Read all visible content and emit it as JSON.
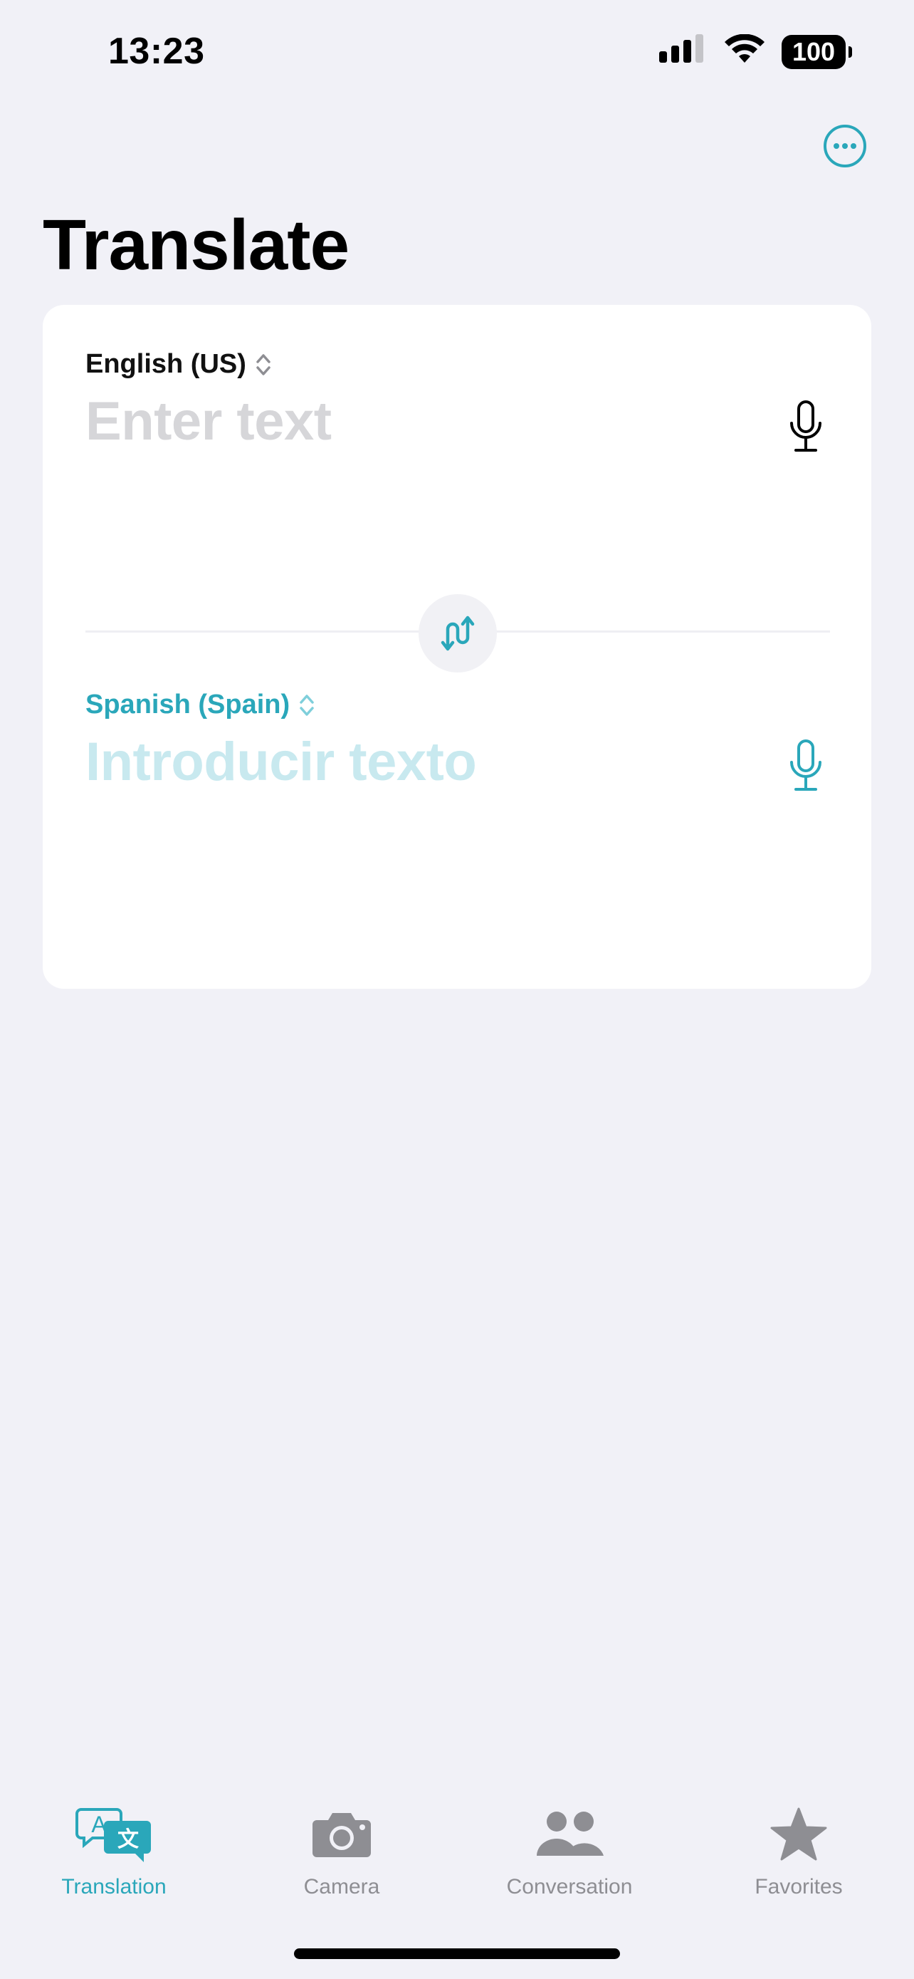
{
  "status_bar": {
    "time": "13:23",
    "battery": "100",
    "icons": [
      "cellular-signal-icon",
      "wifi-icon",
      "battery-icon"
    ]
  },
  "header": {
    "title": "Translate",
    "more_icon": "ellipsis-circle-icon"
  },
  "translator": {
    "source_language": "English (US)",
    "source_placeholder": "Enter text",
    "target_language": "Spanish (Spain)",
    "target_placeholder": "Introducir texto",
    "swap_icon": "swap-languages-icon",
    "mic_icon": "microphone-icon"
  },
  "tabs": [
    {
      "label": "Translation",
      "icon": "translation-icon",
      "active": true
    },
    {
      "label": "Camera",
      "icon": "camera-icon",
      "active": false
    },
    {
      "label": "Conversation",
      "icon": "conversation-icon",
      "active": false
    },
    {
      "label": "Favorites",
      "icon": "star-icon",
      "active": false
    }
  ],
  "colors": {
    "accent": "#2AA7BA",
    "background": "#F1F1F7",
    "card": "#FFFFFF",
    "inactive": "#8E8E93"
  }
}
